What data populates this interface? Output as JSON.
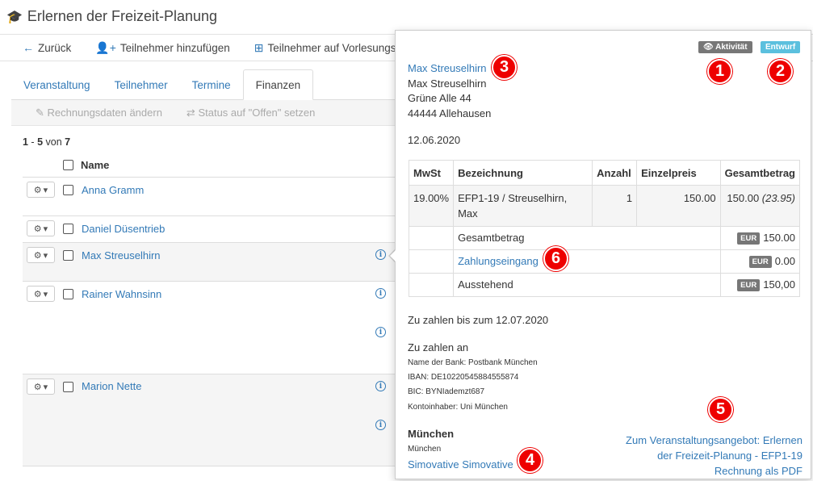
{
  "page_title": "Erlernen der Freizeit-Planung",
  "toolbar": {
    "back": "Zurück",
    "add_participant": "Teilnehmer hinzufügen",
    "participants_series": "Teilnehmer auf Vorlesungsreihe"
  },
  "tabs": [
    "Veranstaltung",
    "Teilnehmer",
    "Termine",
    "Finanzen"
  ],
  "subbar": {
    "edit_invoice": "Rechnungsdaten ändern",
    "set_open": "Status auf \"Offen\" setzen"
  },
  "pager": {
    "from": "1",
    "to": "5",
    "of_word": "von",
    "total": "7"
  },
  "list": {
    "header_name": "Name",
    "rows": [
      "Anna Gramm",
      "Daniel Düsentrieb",
      "Max Streuselhirn",
      "Rainer Wahnsinn",
      "Marion Nette"
    ]
  },
  "popover": {
    "badge_activity": "Aktivität",
    "badge_draft": "Entwurf",
    "recipient_link": "Max Streuselhirn",
    "recipient_name": "Max Streuselhirn",
    "street": "Grüne Alle 44",
    "city": "44444 Allehausen",
    "date": "12.06.2020",
    "table": {
      "headers": [
        "MwSt",
        "Bezeichnung",
        "Anzahl",
        "Einzelpreis",
        "Gesamtbetrag"
      ],
      "item": {
        "vat": "19.00%",
        "desc": "EFP1-19 / Streuselhirn, Max",
        "qty": "1",
        "unit": "150.00",
        "total": "150.00",
        "total_vat": "(23.95)"
      },
      "total_label": "Gesamtbetrag",
      "total_value": "150.00",
      "payment_label": "Zahlungseingang",
      "payment_value": "0.00",
      "outstanding_label": "Ausstehend",
      "outstanding_value": "150,00",
      "currency": "EUR"
    },
    "due": "Zu zahlen bis zum 12.07.2020",
    "pay_to": "Zu zahlen an",
    "bank": "Name der Bank: Postbank München",
    "iban": "IBAN: DE10220545884555874",
    "bic": "BIC: BYNIademzt687",
    "owner": "Kontoinhaber: Uni München",
    "org_city_bold": "München",
    "org_city": "München",
    "org_link": "Simovative Simovative",
    "offer_link_1": "Zum Veranstaltungsangebot: Erlernen",
    "offer_link_2": "der Freizeit-Planung - EFP1-19",
    "pdf_link": "Rechnung als PDF"
  },
  "markers": [
    "1",
    "2",
    "3",
    "4",
    "5",
    "6"
  ],
  "colors": {
    "link": "#337ab7",
    "badge_activity": "#777777",
    "badge_draft": "#5bc0de",
    "marker": "#ee0000"
  }
}
